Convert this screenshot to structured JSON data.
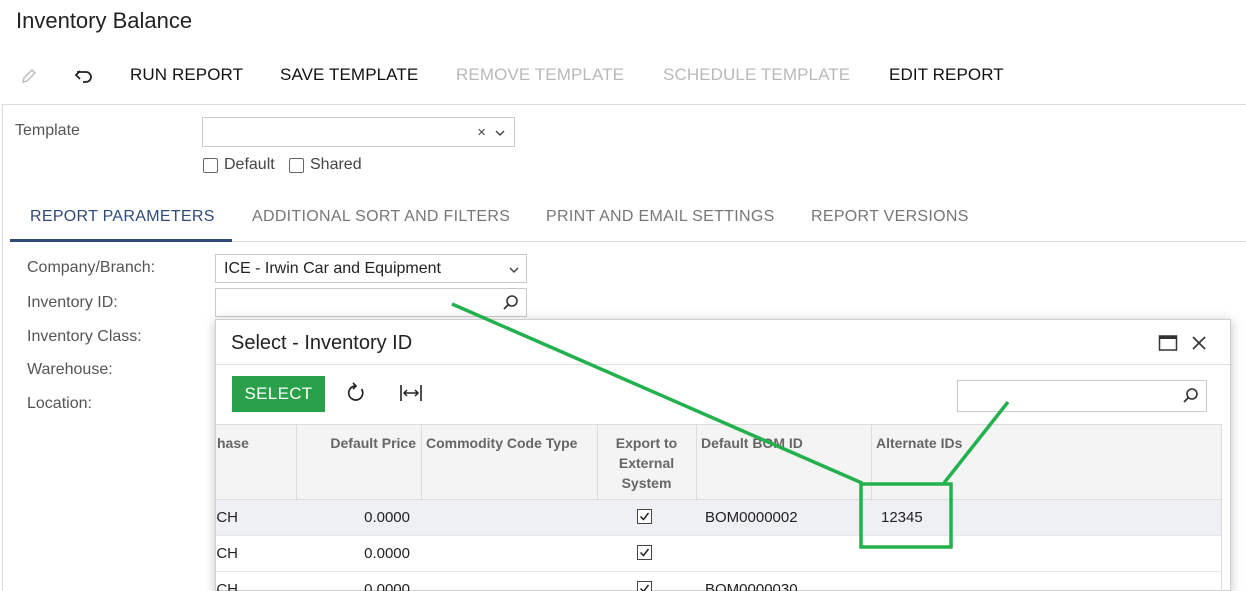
{
  "page": {
    "title": "Inventory Balance"
  },
  "toolbar": {
    "edit_icon": "pencil-icon",
    "undo_icon": "undo-icon",
    "run_report": "RUN REPORT",
    "save_template": "SAVE TEMPLATE",
    "remove_template": "REMOVE TEMPLATE",
    "schedule_template": "SCHEDULE TEMPLATE",
    "edit_report": "EDIT REPORT"
  },
  "template": {
    "label": "Template",
    "value": "",
    "clear_symbol": "×",
    "default_label": "Default",
    "shared_label": "Shared",
    "default_checked": false,
    "shared_checked": false
  },
  "tabs": [
    {
      "label": "REPORT PARAMETERS",
      "active": true
    },
    {
      "label": "ADDITIONAL SORT AND FILTERS",
      "active": false
    },
    {
      "label": "PRINT AND EMAIL SETTINGS",
      "active": false
    },
    {
      "label": "REPORT VERSIONS",
      "active": false
    }
  ],
  "params": {
    "company_label": "Company/Branch:",
    "company_value": "ICE - Irwin Car and Equipment",
    "inventory_id_label": "Inventory ID:",
    "inventory_id_value": "",
    "inventory_class_label": "Inventory Class:",
    "warehouse_label": "Warehouse:",
    "location_label": "Location:"
  },
  "dialog": {
    "title": "Select - Inventory ID",
    "select_button": "SELECT",
    "search_value": "",
    "columns": [
      {
        "label": "hase"
      },
      {
        "label": "Default Price"
      },
      {
        "label": "Commodity Code Type"
      },
      {
        "label": "Export to External System"
      },
      {
        "label": "Default BOM ID"
      },
      {
        "label": "Alternate IDs"
      }
    ],
    "rows": [
      {
        "c0": "CH",
        "price": "0.0000",
        "commodity": "",
        "export": true,
        "bom": "BOM0000002",
        "alt": "12345",
        "selected": true
      },
      {
        "c0": "CH",
        "price": "0.0000",
        "commodity": "",
        "export": true,
        "bom": "",
        "alt": "",
        "selected": false
      },
      {
        "c0": "CH",
        "price": "0.0000",
        "commodity": "",
        "export": true,
        "bom": "BOM0000030",
        "alt": "",
        "selected": false
      }
    ]
  },
  "colors": {
    "accent_tab": "#2f4a7a",
    "select_button": "#2ba04a",
    "annotation": "#22b14c",
    "disabled_text": "#b9b9b9"
  }
}
